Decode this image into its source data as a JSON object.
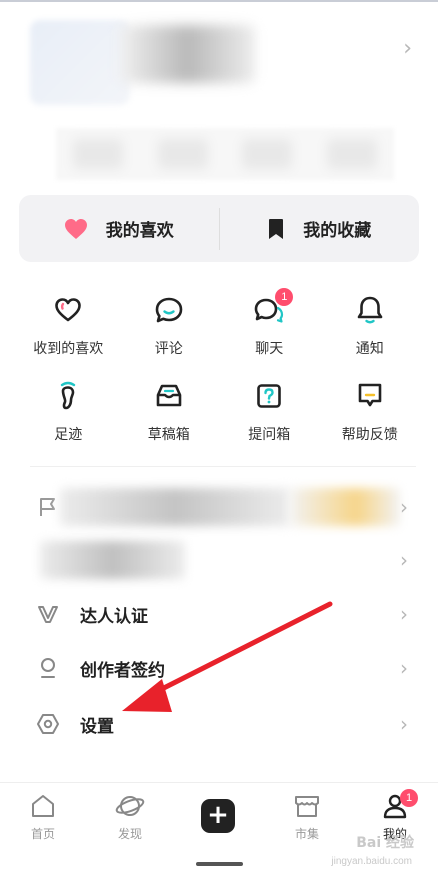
{
  "favorites_card": {
    "likes_label": "我的喜欢",
    "collections_label": "我的收藏"
  },
  "grid": [
    {
      "label": "收到的喜欢",
      "icon": "heart-outline-icon"
    },
    {
      "label": "评论",
      "icon": "comment-bubble-icon"
    },
    {
      "label": "聊天",
      "icon": "chat-bubbles-icon",
      "badge": "1"
    },
    {
      "label": "通知",
      "icon": "bell-icon"
    },
    {
      "label": "足迹",
      "icon": "footprint-icon"
    },
    {
      "label": "草稿箱",
      "icon": "inbox-tray-icon"
    },
    {
      "label": "提问箱",
      "icon": "question-box-icon"
    },
    {
      "label": "帮助反馈",
      "icon": "feedback-icon"
    }
  ],
  "menu": {
    "talent": "达人认证",
    "creator": "创作者签约",
    "settings": "设置"
  },
  "bottom_nav": {
    "home": "首页",
    "discover": "发现",
    "market": "市集",
    "me": "我的",
    "me_badge": "1"
  },
  "watermark": {
    "text": "Bai 经验",
    "sub": "jingyan.baidu.com"
  },
  "colors": {
    "accent_pink": "#ff4d6d",
    "arrow_red": "#e8222b",
    "card_bg": "#f2f2f4"
  }
}
